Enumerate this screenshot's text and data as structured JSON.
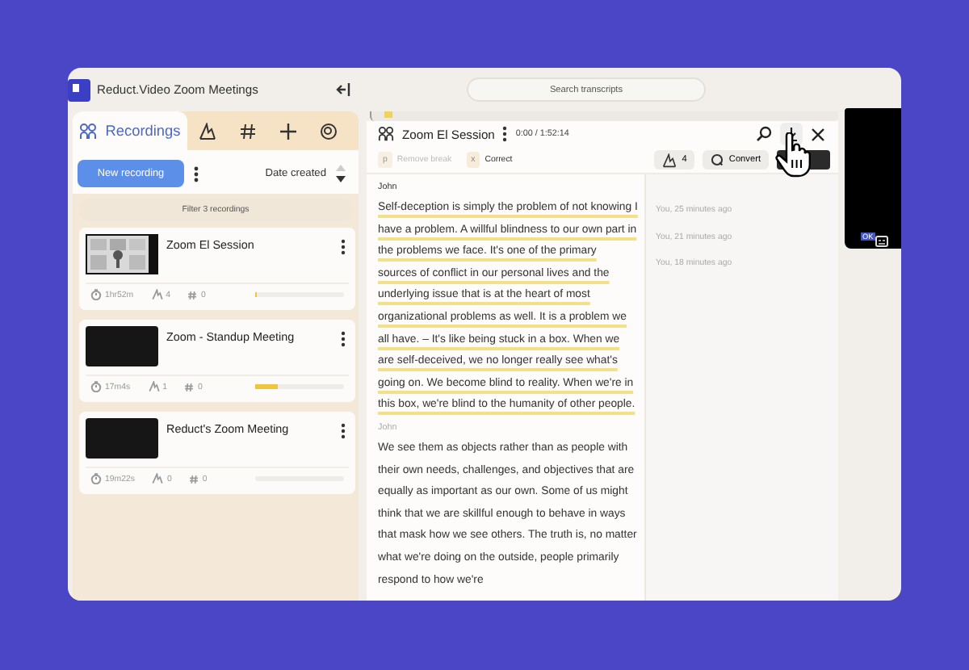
{
  "window": {
    "title": "Reduct.Video Zoom Meetings"
  },
  "search": {
    "placeholder": "Search transcripts"
  },
  "sidebar": {
    "tabs": [
      {
        "kind": "text",
        "label": "Recordings",
        "selected": true
      },
      {
        "kind": "icon",
        "selected": false
      },
      {
        "kind": "icon",
        "selected": false
      },
      {
        "kind": "icon",
        "selected": false
      },
      {
        "kind": "icon",
        "selected": false
      }
    ],
    "new_button": "New recording",
    "sort": "Date created",
    "filter": {
      "placeholder": "Filter 3 recordings"
    },
    "recordings": [
      {
        "title": "Zoom El Session",
        "kind": "picture",
        "duration": "1hr52m",
        "edits": "4",
        "tags": "0",
        "level": 0.02
      },
      {
        "title": "Zoom - Standup Meeting",
        "kind": "video",
        "duration": "17m4s",
        "edits": "1",
        "tags": "0",
        "level": 0.25
      },
      {
        "title": "Reduct's Zoom Meeting",
        "kind": "video",
        "duration": "19m22s",
        "edits": "0",
        "tags": "0",
        "level": 0
      }
    ]
  },
  "editor": {
    "title": "Zoom El Session",
    "time": "0:00 / 1:52:14",
    "toolbar": [
      {
        "key": "p",
        "label": "Remove break",
        "disabled": true
      },
      {
        "key": "x",
        "label": "Correct",
        "disabled": false
      }
    ],
    "edit_count": "4",
    "convert": "Convert",
    "paragraphs": [
      {
        "speaker": "John",
        "selected": true,
        "text": "Self-deception is simply the problem of not knowing I have a problem. A willful blindness to our own part in the problems we face. It's one of the primary sources of conflict in our personal lives and the underlying issue that is at the heart of most organizational problems as well. It is a problem we all have. – It's like being stuck in a box. When we are self-deceived, we no longer really see what's going on. We become blind to reality. When we're in this box, we're blind to the humanity of other people."
      },
      {
        "speaker": "John",
        "selected": false,
        "text": "We see them as objects rather than as people with their own needs, challenges, and objectives that are equally as important as our own. Some of us might think that we are skillful enough to behave in ways that mask how we see others. The truth is, no matter what we're doing on the outside, people primarily respond to how we're"
      }
    ],
    "comments": [
      "You, 25 minutes ago",
      "You, 21 minutes ago",
      "You, 18 minutes ago"
    ]
  },
  "video": {
    "badge": "OK"
  }
}
